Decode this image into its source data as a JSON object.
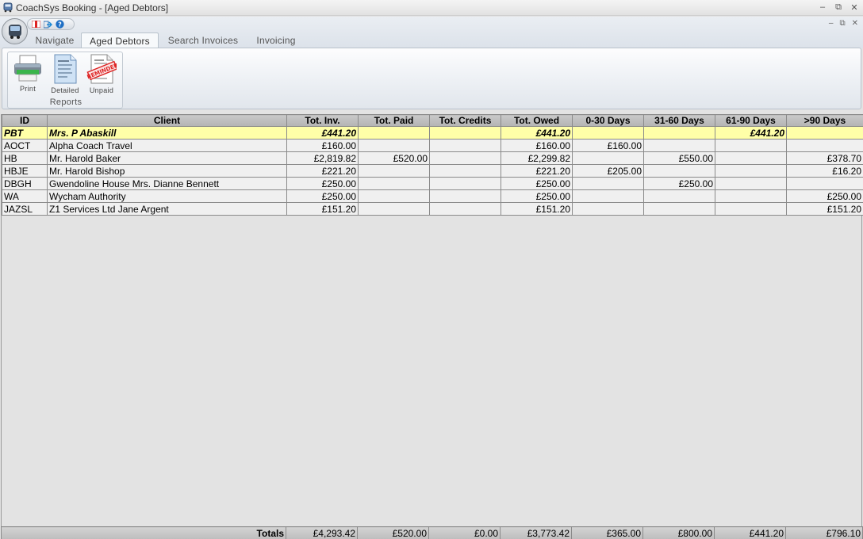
{
  "window": {
    "title": "CoachSys Booking - [Aged Debtors]"
  },
  "tabs": [
    {
      "label": "Navigate"
    },
    {
      "label": "Aged Debtors"
    },
    {
      "label": "Search Invoices"
    },
    {
      "label": "Invoicing"
    }
  ],
  "ribbon": {
    "group_label": "Reports",
    "buttons": [
      {
        "label": "Print",
        "icon": "printer-icon"
      },
      {
        "label": "Detailed",
        "icon": "detailed-report-icon"
      },
      {
        "label": "Unpaid",
        "icon": "reminder-report-icon",
        "stamp": "REMINDER"
      }
    ]
  },
  "table": {
    "columns": [
      "ID",
      "Client",
      "Tot. Inv.",
      "Tot. Paid",
      "Tot. Credits",
      "Tot. Owed",
      "0-30 Days",
      "31-60 Days",
      "61-90 Days",
      ">90 Days"
    ],
    "rows": [
      {
        "id": "PBT",
        "client": "Mrs. P Abaskill",
        "tot_inv": "£441.20",
        "tot_paid": "",
        "tot_credits": "",
        "tot_owed": "£441.20",
        "d0_30": "",
        "d31_60": "",
        "d61_90": "£441.20",
        "d90": ""
      },
      {
        "id": "AOCT",
        "client": "Alpha Coach Travel",
        "tot_inv": "£160.00",
        "tot_paid": "",
        "tot_credits": "",
        "tot_owed": "£160.00",
        "d0_30": "£160.00",
        "d31_60": "",
        "d61_90": "",
        "d90": ""
      },
      {
        "id": "HB",
        "client": "Mr. Harold Baker",
        "tot_inv": "£2,819.82",
        "tot_paid": "£520.00",
        "tot_credits": "",
        "tot_owed": "£2,299.82",
        "d0_30": "",
        "d31_60": "£550.00",
        "d61_90": "",
        "d90": "£378.70"
      },
      {
        "id": "HBJE",
        "client": "Mr. Harold Bishop",
        "tot_inv": "£221.20",
        "tot_paid": "",
        "tot_credits": "",
        "tot_owed": "£221.20",
        "d0_30": "£205.00",
        "d31_60": "",
        "d61_90": "",
        "d90": "£16.20"
      },
      {
        "id": "DBGH",
        "client": "Gwendoline House Mrs. Dianne Bennett",
        "tot_inv": "£250.00",
        "tot_paid": "",
        "tot_credits": "",
        "tot_owed": "£250.00",
        "d0_30": "",
        "d31_60": "£250.00",
        "d61_90": "",
        "d90": ""
      },
      {
        "id": "WA",
        "client": "Wycham Authority",
        "tot_inv": "£250.00",
        "tot_paid": "",
        "tot_credits": "",
        "tot_owed": "£250.00",
        "d0_30": "",
        "d31_60": "",
        "d61_90": "",
        "d90": "£250.00"
      },
      {
        "id": "JAZSL",
        "client": "Z1 Services Ltd Jane Argent",
        "tot_inv": "£151.20",
        "tot_paid": "",
        "tot_credits": "",
        "tot_owed": "£151.20",
        "d0_30": "",
        "d31_60": "",
        "d61_90": "",
        "d90": "£151.20"
      }
    ],
    "selected_row": 0,
    "totals": {
      "label": "Totals",
      "tot_inv": "£4,293.42",
      "tot_paid": "£520.00",
      "tot_credits": "£0.00",
      "tot_owed": "£3,773.42",
      "d0_30": "£365.00",
      "d31_60": "£800.00",
      "d61_90": "£441.20",
      "d90": "£796.10"
    }
  }
}
